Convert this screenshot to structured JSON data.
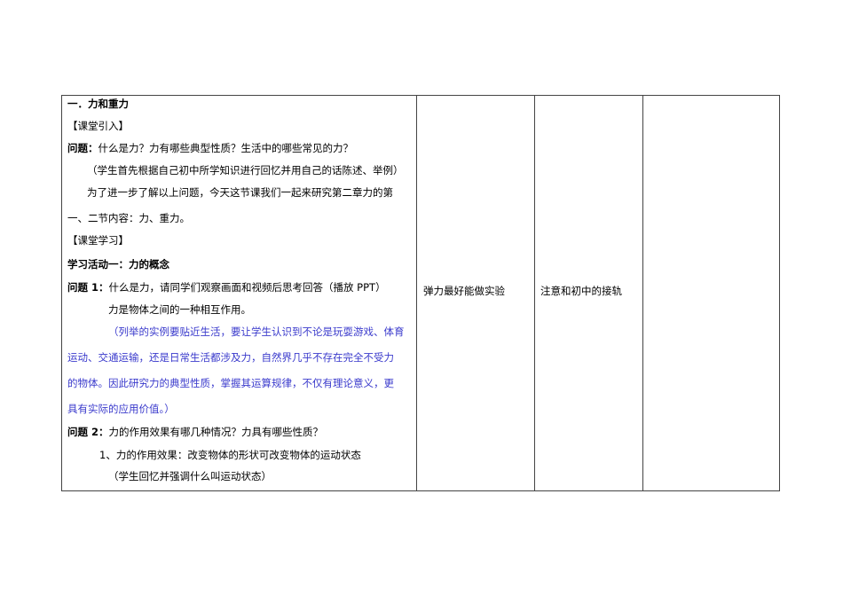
{
  "col1": {
    "heading": "一．力和重力",
    "intro_tag": "【课堂引入】",
    "q_label": "问题：",
    "q_text": "什么是力？力有哪些典型性质？生活中的哪些常见的力？",
    "note1": "（学生首先根据自己初中所学知识进行回忆并用自己的话陈述、举例）",
    "para1": "为了进一步了解以上问题，今天这节课我们一起来研究第二章力的第",
    "para2": "一、二节内容：力、重力。",
    "study_tag": "【课堂学习】",
    "activity1": "学习活动一：力的概念",
    "q1_label": "问题 1：",
    "q1_text": "什么是力，请同学们观察画面和视频后思考回答（播放 PPT）",
    "def": "力是物体之间的一种相互作用。",
    "blue_lines": [
      "（列举的实例要贴近生活，要让学生认识到不论是玩耍游戏、体育",
      "运动、交通运输，还是日常生活都涉及力，自然界几乎不存在完全不受力",
      "的物体。因此研究力的典型性质，掌握其运算规律，不仅有理论意义，更",
      "具有实际的应用价值。）"
    ],
    "q2_label": "问题 2：",
    "q2_text": "力的作用效果有哪几种情况？力具有哪些性质？",
    "effect": "1、力的作用效果：改变物体的形状可改变物体的运动状态",
    "note2": "（学生回忆并强调什么叫运动状态）"
  },
  "col2": "弹力最好能做实验",
  "col3": "注意和初中的接轨",
  "col4": ""
}
